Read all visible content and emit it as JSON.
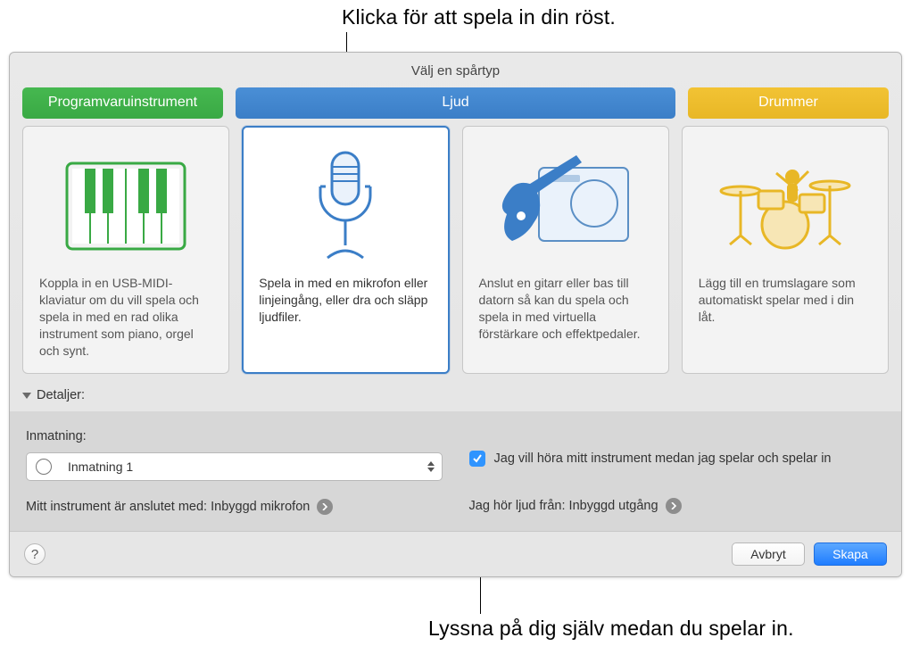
{
  "callouts": {
    "top": "Klicka för att spela in din röst.",
    "bottom": "Lyssna på dig själv medan du spelar in."
  },
  "panel": {
    "title": "Välj en spårtyp"
  },
  "tabs": {
    "software": "Programvaruinstrument",
    "audio": "Ljud",
    "drummer": "Drummer"
  },
  "cards": {
    "software_desc": "Koppla in en USB-MIDI-klaviatur om du vill spela och spela in med en rad olika instrument som piano, orgel och synt.",
    "mic_desc": "Spela in med en mikrofon eller linjeingång, eller dra och släpp ljudfiler.",
    "guitar_desc": "Anslut en gitarr eller bas till datorn så kan du spela och spela in med virtuella förstärkare och effektpedaler.",
    "drummer_desc": "Lägg till en trumslagare som automatiskt spelar med i din låt."
  },
  "details": {
    "header": "Detaljer:",
    "input_label": "Inmatning:",
    "input_value": "Inmatning 1",
    "connected_with": "Mitt instrument är anslutet med: Inbyggd mikrofon",
    "monitor_label": "Jag vill höra mitt instrument medan jag spelar och spelar in",
    "hear_from": "Jag hör ljud från: Inbyggd utgång"
  },
  "footer": {
    "help": "?",
    "cancel": "Avbryt",
    "create": "Skapa"
  },
  "colors": {
    "green": "#39a944",
    "blue": "#3b7ec7",
    "yellow": "#e8b726",
    "accent_blue": "#2f94ff"
  }
}
